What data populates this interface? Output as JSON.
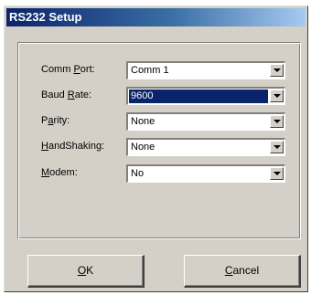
{
  "window": {
    "title": "RS232 Setup"
  },
  "fields": [
    {
      "label_first": "Comm ",
      "label_key": "P",
      "label_rest": "ort:",
      "value": "Comm 1"
    },
    {
      "label_first": "Baud ",
      "label_key": "R",
      "label_rest": "ate:",
      "value": "9600"
    },
    {
      "label_first": "P",
      "label_key": "a",
      "label_rest": "rity:",
      "value": "None"
    },
    {
      "label_first": "",
      "label_key": "H",
      "label_rest": "andShaking:",
      "value": "None"
    },
    {
      "label_first": "",
      "label_key": "M",
      "label_rest": "odem:",
      "value": "No"
    }
  ],
  "buttons": {
    "ok": {
      "key": "O",
      "rest": "K"
    },
    "cancel": {
      "key": "C",
      "rest": "ancel"
    }
  },
  "icons": {
    "dropdown": "chevron-down-icon"
  },
  "colors": {
    "selection": "#0a246a",
    "titlebar": "#0a246a",
    "face": "#d4d0c8"
  }
}
